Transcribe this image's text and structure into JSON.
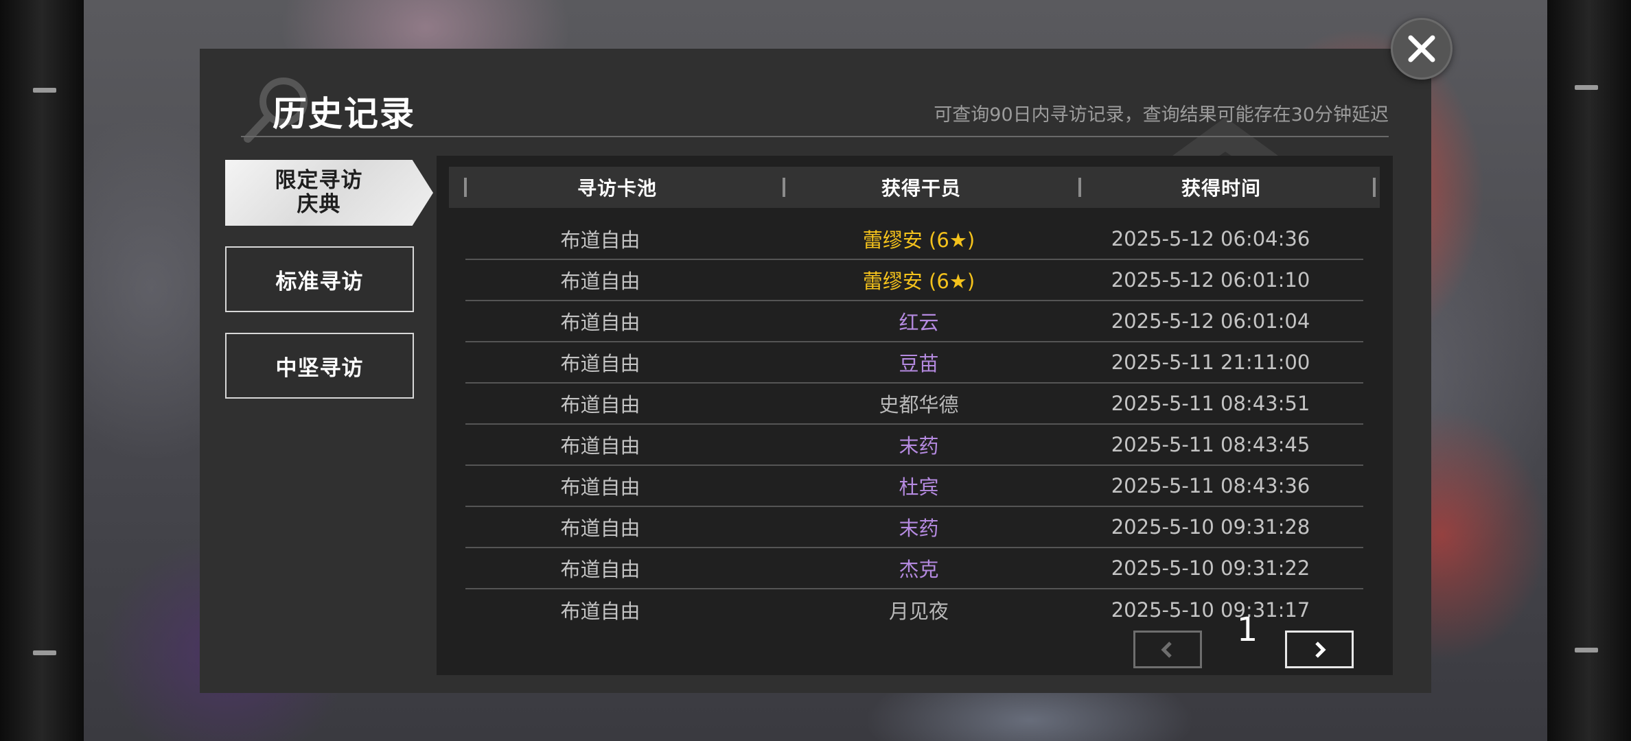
{
  "header": {
    "title": "历史记录",
    "subtitle": "可查询90日内寻访记录，查询结果可能存在30分钟延迟"
  },
  "tabs": [
    {
      "line1": "限定寻访",
      "line2": "庆典",
      "active": true
    },
    {
      "label": "标准寻访",
      "active": false
    },
    {
      "label": "中坚寻访",
      "active": false
    }
  ],
  "table": {
    "headers": [
      "寻访卡池",
      "获得干员",
      "获得时间"
    ],
    "rows": [
      {
        "pool": "布道自由",
        "operator": "蕾缪安 (6★)",
        "rarity_color": "#f4c21c",
        "time": "2025-5-12 06:04:36"
      },
      {
        "pool": "布道自由",
        "operator": "蕾缪安 (6★)",
        "rarity_color": "#f4c21c",
        "time": "2025-5-12 06:01:10"
      },
      {
        "pool": "布道自由",
        "operator": "红云",
        "rarity_color": "#b58ae0",
        "time": "2025-5-12 06:01:04"
      },
      {
        "pool": "布道自由",
        "operator": "豆苗",
        "rarity_color": "#b58ae0",
        "time": "2025-5-11 21:11:00"
      },
      {
        "pool": "布道自由",
        "operator": "史都华德",
        "rarity_color": "#b8b8b8",
        "time": "2025-5-11 08:43:51"
      },
      {
        "pool": "布道自由",
        "operator": "末药",
        "rarity_color": "#b58ae0",
        "time": "2025-5-11 08:43:45"
      },
      {
        "pool": "布道自由",
        "operator": "杜宾",
        "rarity_color": "#b58ae0",
        "time": "2025-5-11 08:43:36"
      },
      {
        "pool": "布道自由",
        "operator": "末药",
        "rarity_color": "#b58ae0",
        "time": "2025-5-10 09:31:28"
      },
      {
        "pool": "布道自由",
        "operator": "杰克",
        "rarity_color": "#b58ae0",
        "time": "2025-5-10 09:31:22"
      },
      {
        "pool": "布道自由",
        "operator": "月见夜",
        "rarity_color": "#b8b8b8",
        "time": "2025-5-10 09:31:17"
      }
    ]
  },
  "pagination": {
    "current_page": "1",
    "prev_icon": "chevron-left-icon",
    "next_icon": "chevron-right-icon"
  },
  "close_icon": "close-icon"
}
